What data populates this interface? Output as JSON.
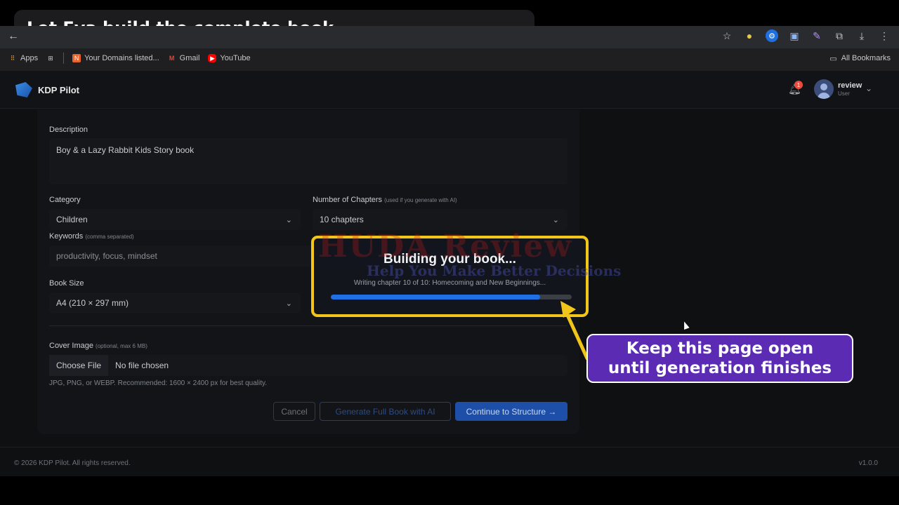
{
  "banner": {
    "title": "Let Eva build the complete book"
  },
  "browser": {
    "bookmarks": [
      {
        "label": "Apps",
        "icon": "apps-grid-icon"
      },
      {
        "label": "Your Domains listed...",
        "icon": "domains-icon"
      },
      {
        "label": "Gmail",
        "icon": "gmail-icon"
      },
      {
        "label": "YouTube",
        "icon": "youtube-icon"
      }
    ],
    "all_bookmarks": "All Bookmarks"
  },
  "app": {
    "logo": "KDP Pilot",
    "notifications": "1",
    "user": {
      "name": "review",
      "role": "User"
    }
  },
  "form": {
    "description_label": "Description",
    "description_value": "Boy & a Lazy Rabbit Kids Story book",
    "category_label": "Category",
    "category_value": "Children",
    "chapters_label": "Number of Chapters",
    "chapters_hint": "(used if you generate with AI)",
    "chapters_value": "10 chapters",
    "keywords_label": "Keywords",
    "keywords_hint": "(comma separated)",
    "keywords_placeholder": "productivity, focus, mindset",
    "booksize_label": "Book Size",
    "booksize_value": "A4 (210 × 297 mm)",
    "cover_label": "Cover Image",
    "cover_hint": "(optional, max 6 MB)",
    "choose_file": "Choose File",
    "no_file": "No file chosen",
    "cover_help": "JPG, PNG, or WEBP. Recommended: 1600 × 2400 px for best quality.",
    "cancel": "Cancel",
    "generate": "Generate Full Book with AI",
    "continue": "Continue to Structure →"
  },
  "modal": {
    "title": "Building your book...",
    "subtitle": "Writing chapter 10 of 10: Homecoming and New Beginnings...",
    "progress_pct": 87
  },
  "callout": {
    "line1": "Keep this page open",
    "line2": "until generation finishes"
  },
  "watermark": {
    "line1": "HUDA Review",
    "line2": "Help You Make Better Decisions"
  },
  "footer": {
    "copyright": "© 2026 KDP Pilot. All rights reserved.",
    "version": "v1.0.0"
  },
  "colors": {
    "accent": "#1f6fe5",
    "highlight": "#f2c51b",
    "callout_bg": "#5b2bb3"
  }
}
